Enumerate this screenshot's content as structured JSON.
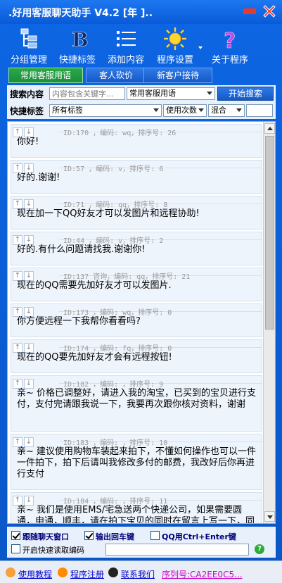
{
  "window": {
    "title": ".好用客服聊天助手 V4.2 [年 ]..",
    "colors": {
      "accent": "#0a5ad8",
      "active_tab": "#2ca84a",
      "close": "#e83a2a"
    }
  },
  "toolbar": {
    "items": [
      {
        "label": "分组管理",
        "icon": "group-tree-icon"
      },
      {
        "label": "快捷标签",
        "icon": "bold-b-icon"
      },
      {
        "label": "添加内容",
        "icon": "list-icon"
      },
      {
        "label": "程序设置",
        "icon": "sun-settings-icon"
      },
      {
        "label": "关于程序",
        "icon": "question-icon"
      }
    ]
  },
  "tabs": [
    {
      "label": "常用客服用语",
      "active": true
    },
    {
      "label": "客人砍价",
      "active": false
    },
    {
      "label": "新客户接待",
      "active": false
    }
  ],
  "search": {
    "label": "搜索内容",
    "placeholder": "内容包含关键字...",
    "category": "常用客服用语",
    "button": "开始搜索"
  },
  "filter": {
    "label": "快捷标签",
    "tag": "所有标签",
    "sort": "使用次数",
    "mode": "混合",
    "extra": ""
  },
  "list": {
    "items": [
      {
        "meta": "ID:170  ，编码: wq，排序号: 26",
        "text": "你好!"
      },
      {
        "meta": "ID:57  ，编码: v，排序号: 6",
        "text": "好的.谢谢!"
      },
      {
        "meta": "ID:71  ，编码: qq，排序号: 8",
        "text": "现在加一下QQ好友才可以发图片和远程协助!"
      },
      {
        "meta": "ID:44  ，编码: v，排序号: 2",
        "text": "好的.有什么问题请找我.谢谢你!"
      },
      {
        "meta": "ID:137  咨询，编码: qq，排序号: 21",
        "text": "现在的QQ需要先加好友才可以发图片."
      },
      {
        "meta": "ID:173  ，编码: wq，排序号: 0",
        "text": "你方便远程一下我帮你看看吗?"
      },
      {
        "meta": "ID:174  ，编码: fq，排序号: 0",
        "text": "现在的QQ要先加好友才会有远程按钮!"
      },
      {
        "meta": "ID:182  ，编码: ，排序号: 9",
        "text": "亲~ 价格已调整好，请进入我的淘宝，已买到的宝贝进行支付，支付完请跟我说一下，我要再次跟你核对资料，谢谢"
      },
      {
        "meta": "ID:183  ，编码: ，排序号: 10",
        "text": "亲~ 建议使用购物车装起来拍下，不懂如何操作也可以一件一件拍下，拍下后请叫我修改多付的邮费，我改好后你再进行支付"
      },
      {
        "meta": "ID:184  ，编码: ，排序号: 11",
        "text": "亲~ 我们是使用EMS/宅急送两个快递公司，如果需要圆通，申通，顺丰，请在拍下宝贝的同时在留言上写一下，同时不拍相应的邮费，都是按实收取哦"
      }
    ]
  },
  "options": {
    "follow_window": "跟随聊天窗口",
    "output_enter": "输出回车键",
    "qq_ctrl_enter": "QQ用Ctrl+Enter键",
    "quick_read": "开启快速读取编码",
    "help_icon_text": "?"
  },
  "status": {
    "tutorial": "使用教程",
    "register": "程序注册",
    "contact": "联系我们",
    "serial": "序列号:CA2EE0C5..."
  }
}
